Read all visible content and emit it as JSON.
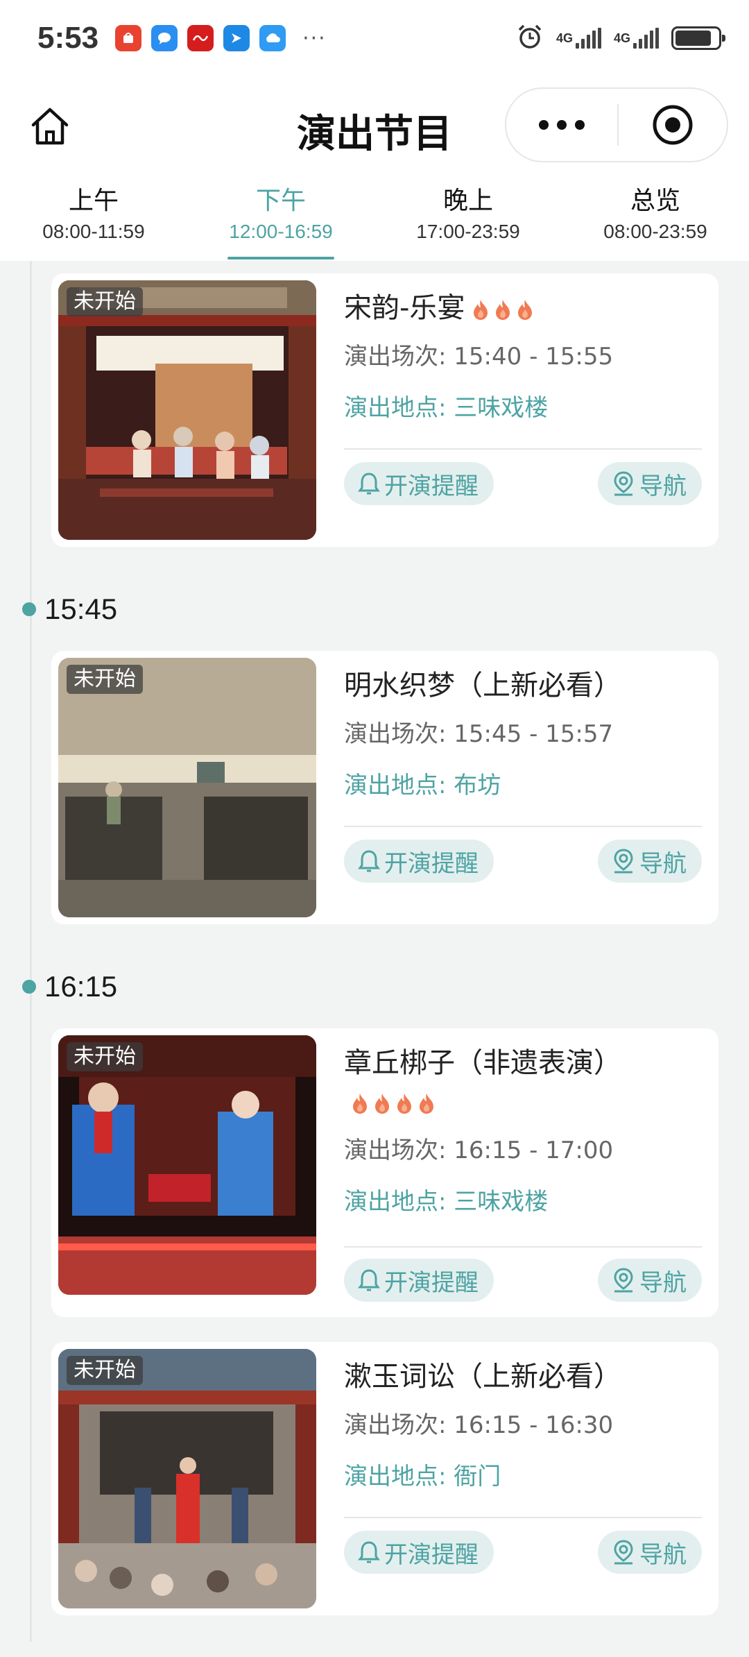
{
  "status_bar": {
    "time": "5:53",
    "more": "···",
    "net1": "4G",
    "net2": "4G",
    "battery_level": 0.85
  },
  "nav": {
    "title": "演出节目"
  },
  "tabs": [
    {
      "name": "上午",
      "range": "08:00-11:59",
      "active": false
    },
    {
      "name": "下午",
      "range": "12:00-16:59",
      "active": true
    },
    {
      "name": "晚上",
      "range": "17:00-23:59",
      "active": false
    },
    {
      "name": "总览",
      "range": "08:00-23:59",
      "active": false
    }
  ],
  "timeline": [
    "15:45",
    "16:15"
  ],
  "cards": [
    {
      "badge": "未开始",
      "title": "宋韵-乐宴",
      "hot": 3,
      "time_label": "演出场次:",
      "time_value": "15:40 - 15:55",
      "place_label": "演出地点:",
      "place_value": "三味戏楼",
      "remind": "开演提醒",
      "nav": "导航"
    },
    {
      "badge": "未开始",
      "title": "明水织梦（上新必看）",
      "hot": 0,
      "time_label": "演出场次:",
      "time_value": "15:45 - 15:57",
      "place_label": "演出地点:",
      "place_value": "布坊",
      "remind": "开演提醒",
      "nav": "导航"
    },
    {
      "badge": "未开始",
      "title": "章丘梆子（非遗表演）",
      "hot": 4,
      "time_label": "演出场次:",
      "time_value": "16:15 - 17:00",
      "place_label": "演出地点:",
      "place_value": "三味戏楼",
      "remind": "开演提醒",
      "nav": "导航"
    },
    {
      "badge": "未开始",
      "title": "漱玉词讼（上新必看）",
      "hot": 0,
      "time_label": "演出场次:",
      "time_value": "16:15 - 16:30",
      "place_label": "演出地点:",
      "place_value": "衙门",
      "remind": "开演提醒",
      "nav": "导航"
    }
  ],
  "colors": {
    "accent": "#4ea3a3",
    "pill_bg": "#e3efee",
    "page_bg": "#f2f4f3",
    "flame": "#f07a52"
  },
  "icons": [
    "home-icon",
    "more-icon",
    "target-close-icon",
    "bell-icon",
    "location-icon",
    "flame-icon"
  ]
}
